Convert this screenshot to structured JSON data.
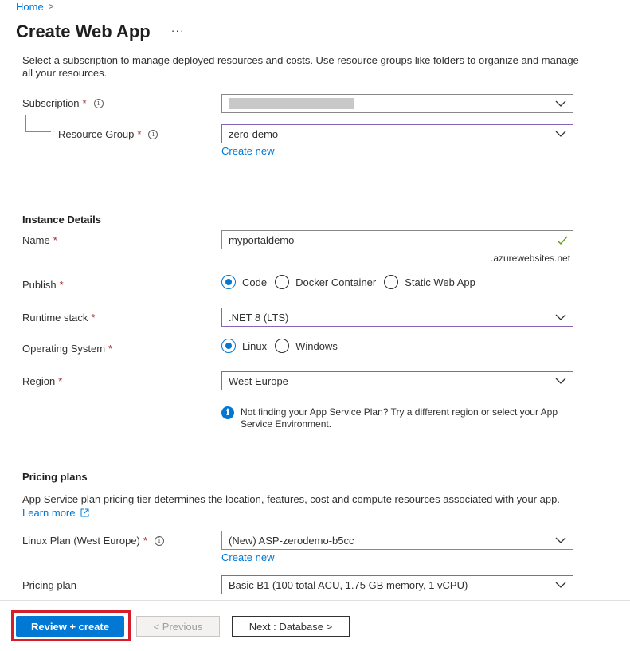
{
  "breadcrumb": {
    "home": "Home",
    "separator": ">"
  },
  "header": {
    "title": "Create Web App",
    "more_icon": "ellipsis-icon",
    "more": "···"
  },
  "intro_text": "Select a subscription to manage deployed resources and costs. Use resource groups like folders to organize and manage all your resources.",
  "subscription": {
    "label": "Subscription",
    "required": "*",
    "info": "i",
    "value": ""
  },
  "resource_group": {
    "label": "Resource Group",
    "required": "*",
    "info": "i",
    "value": "zero-demo",
    "create_new": "Create new"
  },
  "instance_details": {
    "title": "Instance Details",
    "name": {
      "label": "Name",
      "required": "*",
      "value": "myportaldemo",
      "suffix": ".azurewebsites.net",
      "valid_icon": "checkmark-icon"
    },
    "publish": {
      "label": "Publish",
      "required": "*",
      "options": [
        "Code",
        "Docker Container",
        "Static Web App"
      ],
      "selected": "Code"
    },
    "runtime_stack": {
      "label": "Runtime stack",
      "required": "*",
      "value": ".NET 8 (LTS)"
    },
    "os": {
      "label": "Operating System",
      "required": "*",
      "options": [
        "Linux",
        "Windows"
      ],
      "selected": "Linux"
    },
    "region": {
      "label": "Region",
      "required": "*",
      "value": "West Europe"
    },
    "region_info": "Not finding your App Service Plan? Try a different region or select your App Service Environment."
  },
  "pricing": {
    "title": "Pricing plans",
    "description": "App Service plan pricing tier determines the location, features, cost and compute resources associated with your app.",
    "learn_more": "Learn more",
    "linux_plan": {
      "label": "Linux Plan (West Europe)",
      "required": "*",
      "info": "i",
      "value": "(New) ASP-zerodemo-b5cc",
      "create_new": "Create new"
    },
    "pricing_plan": {
      "label": "Pricing plan",
      "value": "Basic B1 (100 total ACU, 1.75 GB memory, 1 vCPU)"
    }
  },
  "footer": {
    "review_create": "Review + create",
    "previous": "< Previous",
    "next": "Next : Database >"
  },
  "colors": {
    "accent": "#0078d4",
    "required": "#a4262c",
    "highlight": "#d41f2b",
    "focus_border": "#8764b8"
  }
}
